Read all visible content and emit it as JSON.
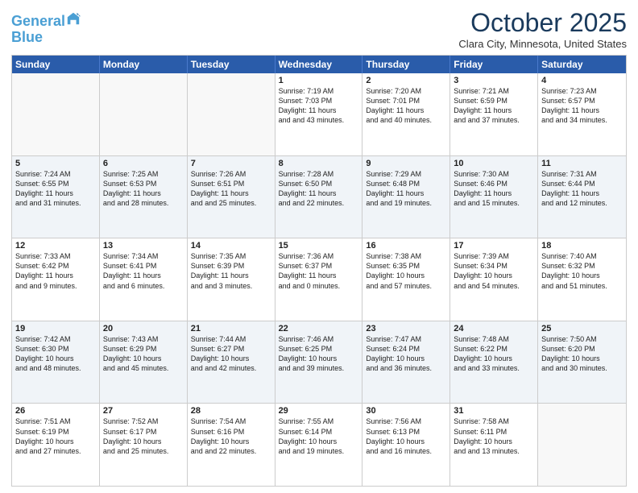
{
  "header": {
    "logo_line1": "General",
    "logo_line2": "Blue",
    "month": "October 2025",
    "location": "Clara City, Minnesota, United States"
  },
  "weekdays": [
    "Sunday",
    "Monday",
    "Tuesday",
    "Wednesday",
    "Thursday",
    "Friday",
    "Saturday"
  ],
  "rows": [
    [
      {
        "day": "",
        "sunrise": "",
        "sunset": "",
        "daylight": "",
        "empty": true
      },
      {
        "day": "",
        "sunrise": "",
        "sunset": "",
        "daylight": "",
        "empty": true
      },
      {
        "day": "",
        "sunrise": "",
        "sunset": "",
        "daylight": "",
        "empty": true
      },
      {
        "day": "1",
        "sunrise": "Sunrise: 7:19 AM",
        "sunset": "Sunset: 7:03 PM",
        "daylight": "Daylight: 11 hours and 43 minutes."
      },
      {
        "day": "2",
        "sunrise": "Sunrise: 7:20 AM",
        "sunset": "Sunset: 7:01 PM",
        "daylight": "Daylight: 11 hours and 40 minutes."
      },
      {
        "day": "3",
        "sunrise": "Sunrise: 7:21 AM",
        "sunset": "Sunset: 6:59 PM",
        "daylight": "Daylight: 11 hours and 37 minutes."
      },
      {
        "day": "4",
        "sunrise": "Sunrise: 7:23 AM",
        "sunset": "Sunset: 6:57 PM",
        "daylight": "Daylight: 11 hours and 34 minutes."
      }
    ],
    [
      {
        "day": "5",
        "sunrise": "Sunrise: 7:24 AM",
        "sunset": "Sunset: 6:55 PM",
        "daylight": "Daylight: 11 hours and 31 minutes."
      },
      {
        "day": "6",
        "sunrise": "Sunrise: 7:25 AM",
        "sunset": "Sunset: 6:53 PM",
        "daylight": "Daylight: 11 hours and 28 minutes."
      },
      {
        "day": "7",
        "sunrise": "Sunrise: 7:26 AM",
        "sunset": "Sunset: 6:51 PM",
        "daylight": "Daylight: 11 hours and 25 minutes."
      },
      {
        "day": "8",
        "sunrise": "Sunrise: 7:28 AM",
        "sunset": "Sunset: 6:50 PM",
        "daylight": "Daylight: 11 hours and 22 minutes."
      },
      {
        "day": "9",
        "sunrise": "Sunrise: 7:29 AM",
        "sunset": "Sunset: 6:48 PM",
        "daylight": "Daylight: 11 hours and 19 minutes."
      },
      {
        "day": "10",
        "sunrise": "Sunrise: 7:30 AM",
        "sunset": "Sunset: 6:46 PM",
        "daylight": "Daylight: 11 hours and 15 minutes."
      },
      {
        "day": "11",
        "sunrise": "Sunrise: 7:31 AM",
        "sunset": "Sunset: 6:44 PM",
        "daylight": "Daylight: 11 hours and 12 minutes."
      }
    ],
    [
      {
        "day": "12",
        "sunrise": "Sunrise: 7:33 AM",
        "sunset": "Sunset: 6:42 PM",
        "daylight": "Daylight: 11 hours and 9 minutes."
      },
      {
        "day": "13",
        "sunrise": "Sunrise: 7:34 AM",
        "sunset": "Sunset: 6:41 PM",
        "daylight": "Daylight: 11 hours and 6 minutes."
      },
      {
        "day": "14",
        "sunrise": "Sunrise: 7:35 AM",
        "sunset": "Sunset: 6:39 PM",
        "daylight": "Daylight: 11 hours and 3 minutes."
      },
      {
        "day": "15",
        "sunrise": "Sunrise: 7:36 AM",
        "sunset": "Sunset: 6:37 PM",
        "daylight": "Daylight: 11 hours and 0 minutes."
      },
      {
        "day": "16",
        "sunrise": "Sunrise: 7:38 AM",
        "sunset": "Sunset: 6:35 PM",
        "daylight": "Daylight: 10 hours and 57 minutes."
      },
      {
        "day": "17",
        "sunrise": "Sunrise: 7:39 AM",
        "sunset": "Sunset: 6:34 PM",
        "daylight": "Daylight: 10 hours and 54 minutes."
      },
      {
        "day": "18",
        "sunrise": "Sunrise: 7:40 AM",
        "sunset": "Sunset: 6:32 PM",
        "daylight": "Daylight: 10 hours and 51 minutes."
      }
    ],
    [
      {
        "day": "19",
        "sunrise": "Sunrise: 7:42 AM",
        "sunset": "Sunset: 6:30 PM",
        "daylight": "Daylight: 10 hours and 48 minutes."
      },
      {
        "day": "20",
        "sunrise": "Sunrise: 7:43 AM",
        "sunset": "Sunset: 6:29 PM",
        "daylight": "Daylight: 10 hours and 45 minutes."
      },
      {
        "day": "21",
        "sunrise": "Sunrise: 7:44 AM",
        "sunset": "Sunset: 6:27 PM",
        "daylight": "Daylight: 10 hours and 42 minutes."
      },
      {
        "day": "22",
        "sunrise": "Sunrise: 7:46 AM",
        "sunset": "Sunset: 6:25 PM",
        "daylight": "Daylight: 10 hours and 39 minutes."
      },
      {
        "day": "23",
        "sunrise": "Sunrise: 7:47 AM",
        "sunset": "Sunset: 6:24 PM",
        "daylight": "Daylight: 10 hours and 36 minutes."
      },
      {
        "day": "24",
        "sunrise": "Sunrise: 7:48 AM",
        "sunset": "Sunset: 6:22 PM",
        "daylight": "Daylight: 10 hours and 33 minutes."
      },
      {
        "day": "25",
        "sunrise": "Sunrise: 7:50 AM",
        "sunset": "Sunset: 6:20 PM",
        "daylight": "Daylight: 10 hours and 30 minutes."
      }
    ],
    [
      {
        "day": "26",
        "sunrise": "Sunrise: 7:51 AM",
        "sunset": "Sunset: 6:19 PM",
        "daylight": "Daylight: 10 hours and 27 minutes."
      },
      {
        "day": "27",
        "sunrise": "Sunrise: 7:52 AM",
        "sunset": "Sunset: 6:17 PM",
        "daylight": "Daylight: 10 hours and 25 minutes."
      },
      {
        "day": "28",
        "sunrise": "Sunrise: 7:54 AM",
        "sunset": "Sunset: 6:16 PM",
        "daylight": "Daylight: 10 hours and 22 minutes."
      },
      {
        "day": "29",
        "sunrise": "Sunrise: 7:55 AM",
        "sunset": "Sunset: 6:14 PM",
        "daylight": "Daylight: 10 hours and 19 minutes."
      },
      {
        "day": "30",
        "sunrise": "Sunrise: 7:56 AM",
        "sunset": "Sunset: 6:13 PM",
        "daylight": "Daylight: 10 hours and 16 minutes."
      },
      {
        "day": "31",
        "sunrise": "Sunrise: 7:58 AM",
        "sunset": "Sunset: 6:11 PM",
        "daylight": "Daylight: 10 hours and 13 minutes."
      },
      {
        "day": "",
        "sunrise": "",
        "sunset": "",
        "daylight": "",
        "empty": true
      }
    ]
  ]
}
